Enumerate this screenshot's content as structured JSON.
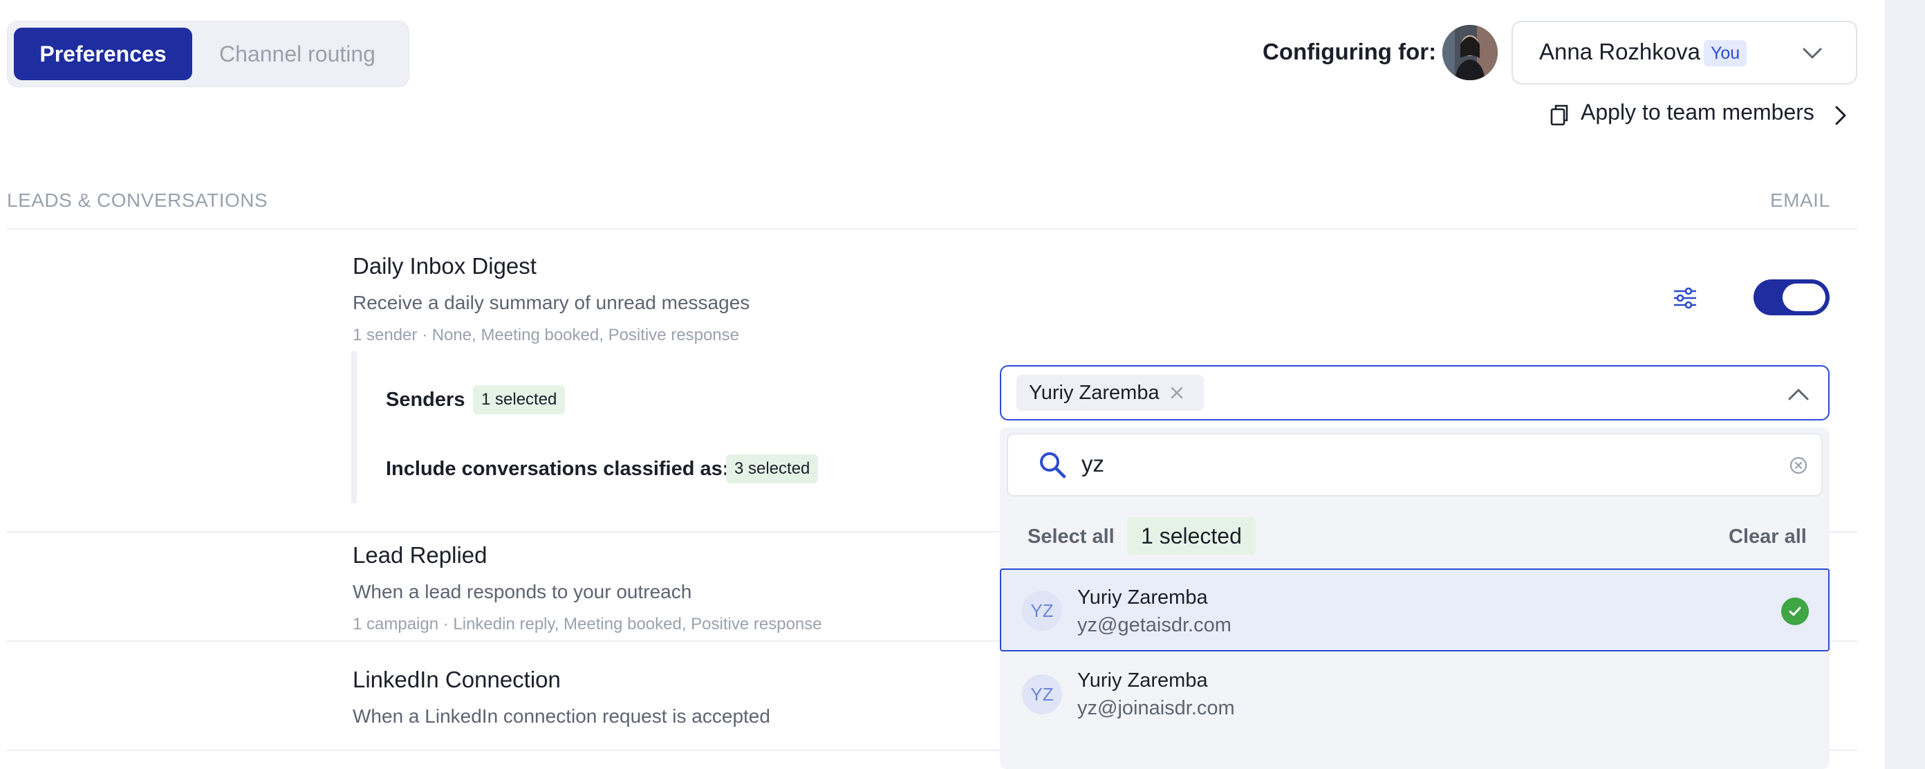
{
  "tabs": [
    {
      "label": "Preferences",
      "active": true
    },
    {
      "label": "Channel routing",
      "active": false
    }
  ],
  "config": {
    "label": "Configuring for:",
    "user_name": "Anna Rozhkova",
    "you_badge": "You",
    "apply_label": "Apply to team members"
  },
  "section": {
    "label": "LEADS & CONVERSATIONS",
    "column": "EMAIL"
  },
  "rows": [
    {
      "title": "Daily Inbox Digest",
      "desc": "Receive a daily summary of unread messages",
      "meta": "1 sender · None, Meeting booked, Positive response",
      "enabled": true
    },
    {
      "title": "Lead Replied",
      "desc": "When a lead responds to your outreach",
      "meta": "1 campaign · Linkedin reply, Meeting booked, Positive response"
    },
    {
      "title": "LinkedIn Connection",
      "desc": "When a LinkedIn connection request is accepted"
    }
  ],
  "digest_settings": {
    "senders_label": "Senders",
    "senders_count": "1 selected",
    "classified_label": "Include conversations classified as:",
    "classified_count": "3 selected"
  },
  "dropdown": {
    "chip": "Yuriy Zaremba",
    "search_value": "yz",
    "select_all": "Select all",
    "selected_count": "1 selected",
    "clear_all": "Clear all",
    "options": [
      {
        "initials": "YZ",
        "name": "Yuriy Zaremba",
        "email": "yz@getaisdr.com",
        "selected": true
      },
      {
        "initials": "YZ",
        "name": "Yuriy Zaremba",
        "email": "yz@joinaisdr.com",
        "selected": false
      }
    ]
  },
  "colors": {
    "accent": "#1e2d9f",
    "link_blue": "#2c4bd1",
    "success": "#3fa545",
    "muted": "#9aa1ad"
  },
  "icons": [
    "chevron-down-icon",
    "copy-icon",
    "chevron-right-icon",
    "sliders-icon",
    "close-icon",
    "chevron-up-icon",
    "search-icon",
    "clear-circle-icon",
    "check-circle-icon"
  ]
}
